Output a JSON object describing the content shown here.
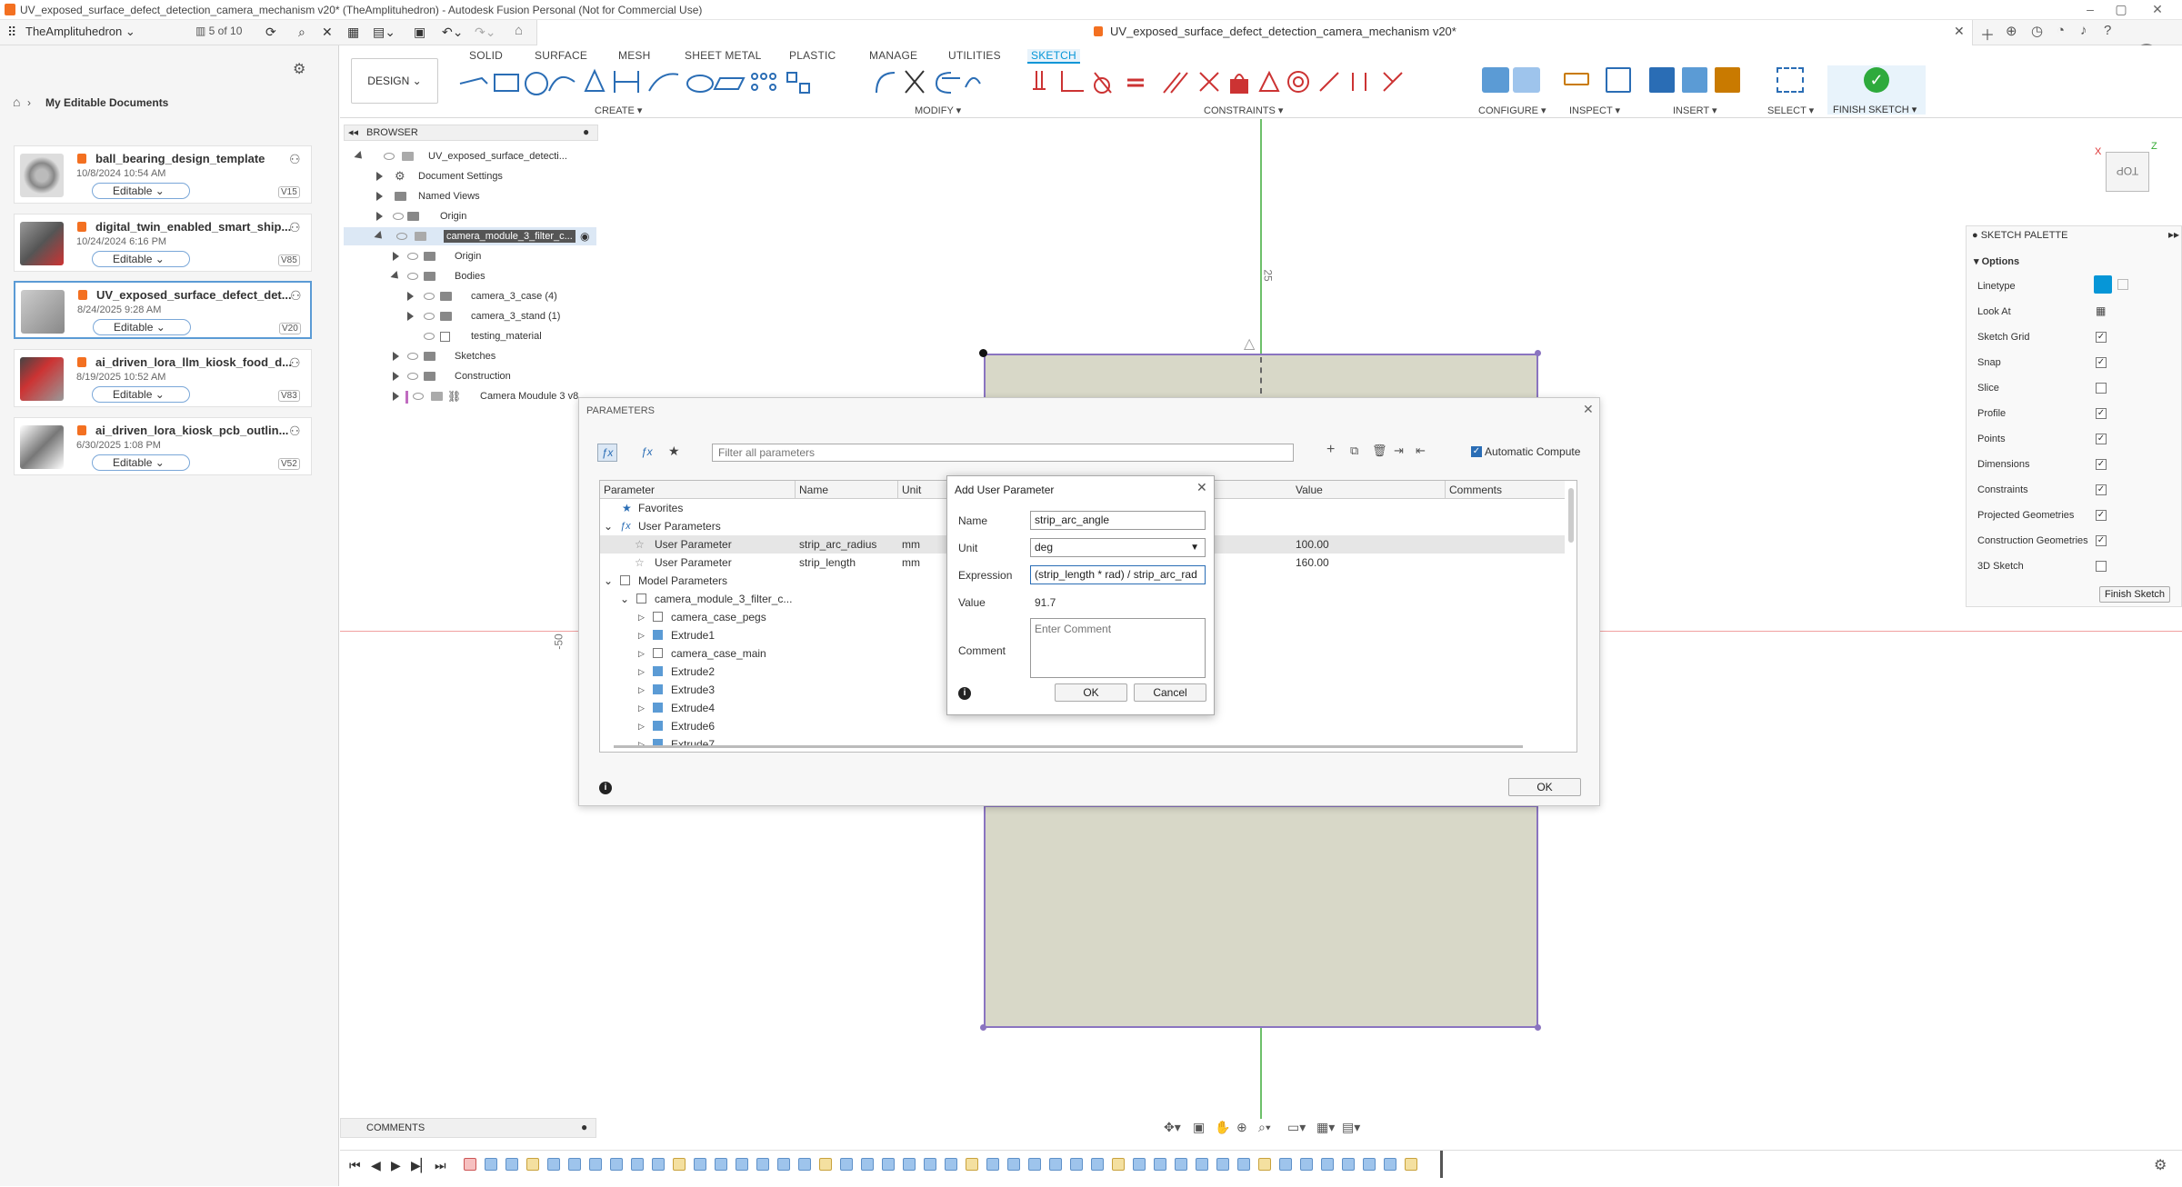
{
  "window": {
    "title": "UV_exposed_surface_defect_detection_camera_mechanism v20* (TheAmplituhedron) - Autodesk Fusion Personal (Not for Commercial Use)"
  },
  "appbar": {
    "team": "TheAmplituhedron",
    "job_status": "5 of 10",
    "doc_tab": "UV_exposed_surface_defect_detection_camera_mechanism v20*"
  },
  "data_panel": {
    "breadcrumb": "My Editable Documents",
    "documents": [
      {
        "name": "ball_bearing_design_template",
        "date": "10/8/2024 10:54 AM",
        "status": "Editable",
        "version": "V15"
      },
      {
        "name": "digital_twin_enabled_smart_ship...",
        "date": "10/24/2024 6:16 PM",
        "status": "Editable",
        "version": "V85"
      },
      {
        "name": "UV_exposed_surface_defect_det...",
        "date": "8/24/2025 9:28 AM",
        "status": "Editable",
        "version": "V20"
      },
      {
        "name": "ai_driven_lora_llm_kiosk_food_d...",
        "date": "8/19/2025 10:52 AM",
        "status": "Editable",
        "version": "V83"
      },
      {
        "name": "ai_driven_lora_kiosk_pcb_outlin...",
        "date": "6/30/2025 1:08 PM",
        "status": "Editable",
        "version": "V52"
      }
    ]
  },
  "ribbon": {
    "workspace": "DESIGN",
    "tabs": [
      "SOLID",
      "SURFACE",
      "MESH",
      "SHEET METAL",
      "PLASTIC",
      "MANAGE",
      "UTILITIES",
      "SKETCH"
    ],
    "groups": {
      "create": "CREATE",
      "modify": "MODIFY",
      "constraints": "CONSTRAINTS",
      "configure": "CONFIGURE",
      "inspect": "INSPECT",
      "insert": "INSERT",
      "select": "SELECT",
      "finish": "FINISH SKETCH"
    }
  },
  "browser": {
    "title": "BROWSER",
    "items": [
      "UV_exposed_surface_detecti...",
      "Document Settings",
      "Named Views",
      "Origin",
      "camera_module_3_filter_c...",
      "Origin",
      "Bodies",
      "camera_3_case (4)",
      "camera_3_stand (1)",
      "testing_material",
      "Sketches",
      "Construction",
      "Camera Moudule 3 v8"
    ]
  },
  "canvas": {
    "dim_top": "25",
    "dim_left": "-50",
    "viewcube": "TOP"
  },
  "parameters": {
    "title": "PARAMETERS",
    "filter_placeholder": "Filter all parameters",
    "auto_compute": "Automatic Compute",
    "columns": [
      "Parameter",
      "Name",
      "Unit",
      "Value",
      "Comments"
    ],
    "rows": [
      {
        "label": "Favorites",
        "name": "",
        "unit": "",
        "value": ""
      },
      {
        "label": "User Parameters",
        "name": "",
        "unit": "",
        "value": ""
      },
      {
        "label": "User Parameter",
        "name": "strip_arc_radius",
        "unit": "mm",
        "value": "100.00"
      },
      {
        "label": "User Parameter",
        "name": "strip_length",
        "unit": "mm",
        "value": "160.00"
      },
      {
        "label": "Model Parameters",
        "name": "",
        "unit": "",
        "value": ""
      },
      {
        "label": "camera_module_3_filter_c...",
        "name": "",
        "unit": "",
        "value": ""
      },
      {
        "label": "camera_case_pegs",
        "name": "",
        "unit": "",
        "value": ""
      },
      {
        "label": "Extrude1",
        "name": "",
        "unit": "",
        "value": ""
      },
      {
        "label": "camera_case_main",
        "name": "",
        "unit": "",
        "value": ""
      },
      {
        "label": "Extrude2",
        "name": "",
        "unit": "",
        "value": ""
      },
      {
        "label": "Extrude3",
        "name": "",
        "unit": "",
        "value": ""
      },
      {
        "label": "Extrude4",
        "name": "",
        "unit": "",
        "value": ""
      },
      {
        "label": "Extrude6",
        "name": "",
        "unit": "",
        "value": ""
      },
      {
        "label": "Extrude7",
        "name": "",
        "unit": "",
        "value": ""
      }
    ],
    "ok": "OK"
  },
  "add_param": {
    "title": "Add User Parameter",
    "name_label": "Name",
    "name_value": "strip_arc_angle",
    "unit_label": "Unit",
    "unit_value": "deg",
    "expr_label": "Expression",
    "expr_value": "(strip_length * rad) / strip_arc_rad",
    "value_label": "Value",
    "value_value": "91.7",
    "comment_label": "Comment",
    "comment_placeholder": "Enter Comment",
    "ok": "OK",
    "cancel": "Cancel"
  },
  "palette": {
    "title": "SKETCH PALETTE",
    "section": "Options",
    "rows": [
      {
        "label": "Linetype",
        "checked": null
      },
      {
        "label": "Look At",
        "checked": null
      },
      {
        "label": "Sketch Grid",
        "checked": true
      },
      {
        "label": "Snap",
        "checked": true
      },
      {
        "label": "Slice",
        "checked": false
      },
      {
        "label": "Profile",
        "checked": true
      },
      {
        "label": "Points",
        "checked": true
      },
      {
        "label": "Dimensions",
        "checked": true
      },
      {
        "label": "Constraints",
        "checked": true
      },
      {
        "label": "Projected Geometries",
        "checked": true
      },
      {
        "label": "Construction Geometries",
        "checked": true
      },
      {
        "label": "3D Sketch",
        "checked": false
      }
    ],
    "finish": "Finish Sketch"
  },
  "comments": {
    "label": "COMMENTS"
  },
  "colors": {
    "accent": "#0696d7",
    "sketch_fill": "#d8d8c8",
    "sketch_edge": "#8a74c0"
  }
}
